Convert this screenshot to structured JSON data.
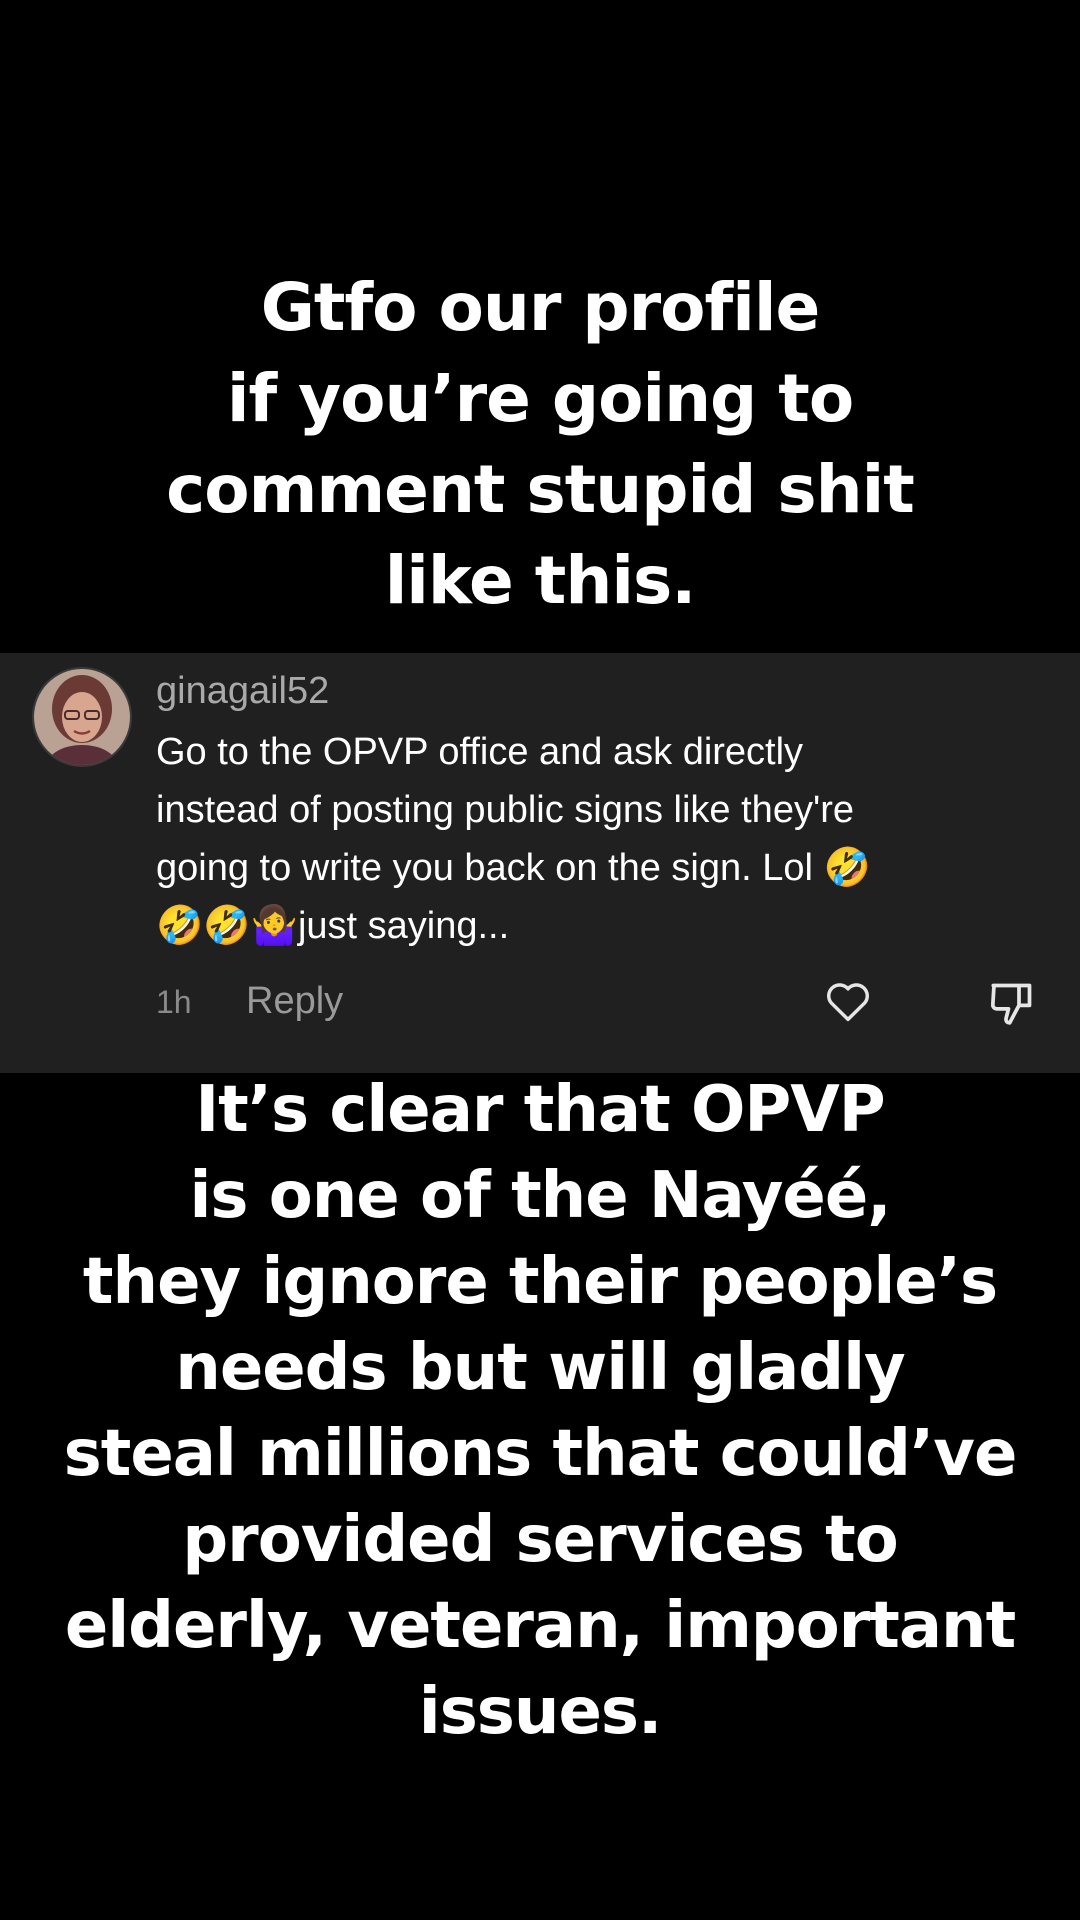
{
  "caption_top": "Gtfo our profile\nif you’re going to\ncomment stupid shit\nlike this.",
  "comment": {
    "username": "ginagail52",
    "text": "Go to the OPVP office and ask directly\ninstead of posting public signs like they're\ngoing to write you back on the sign. Lol 🤣\n🤣🤣🤷‍♀️just saying...",
    "time": "1h",
    "reply_label": "Reply",
    "like_icon": "heart-outline",
    "dislike_icon": "thumbs-down-outline"
  },
  "caption_bottom": "It’s clear that OPVP\nis one of the Nayéé,\nthey ignore their people’s\nneeds but will gladly\nsteal millions that could’ve\nprovided services to\nelderly, veteran, important\nissues.",
  "colors": {
    "background": "#000000",
    "card": "#202020",
    "text": "#ffffff",
    "muted": "#a9a9a9"
  }
}
